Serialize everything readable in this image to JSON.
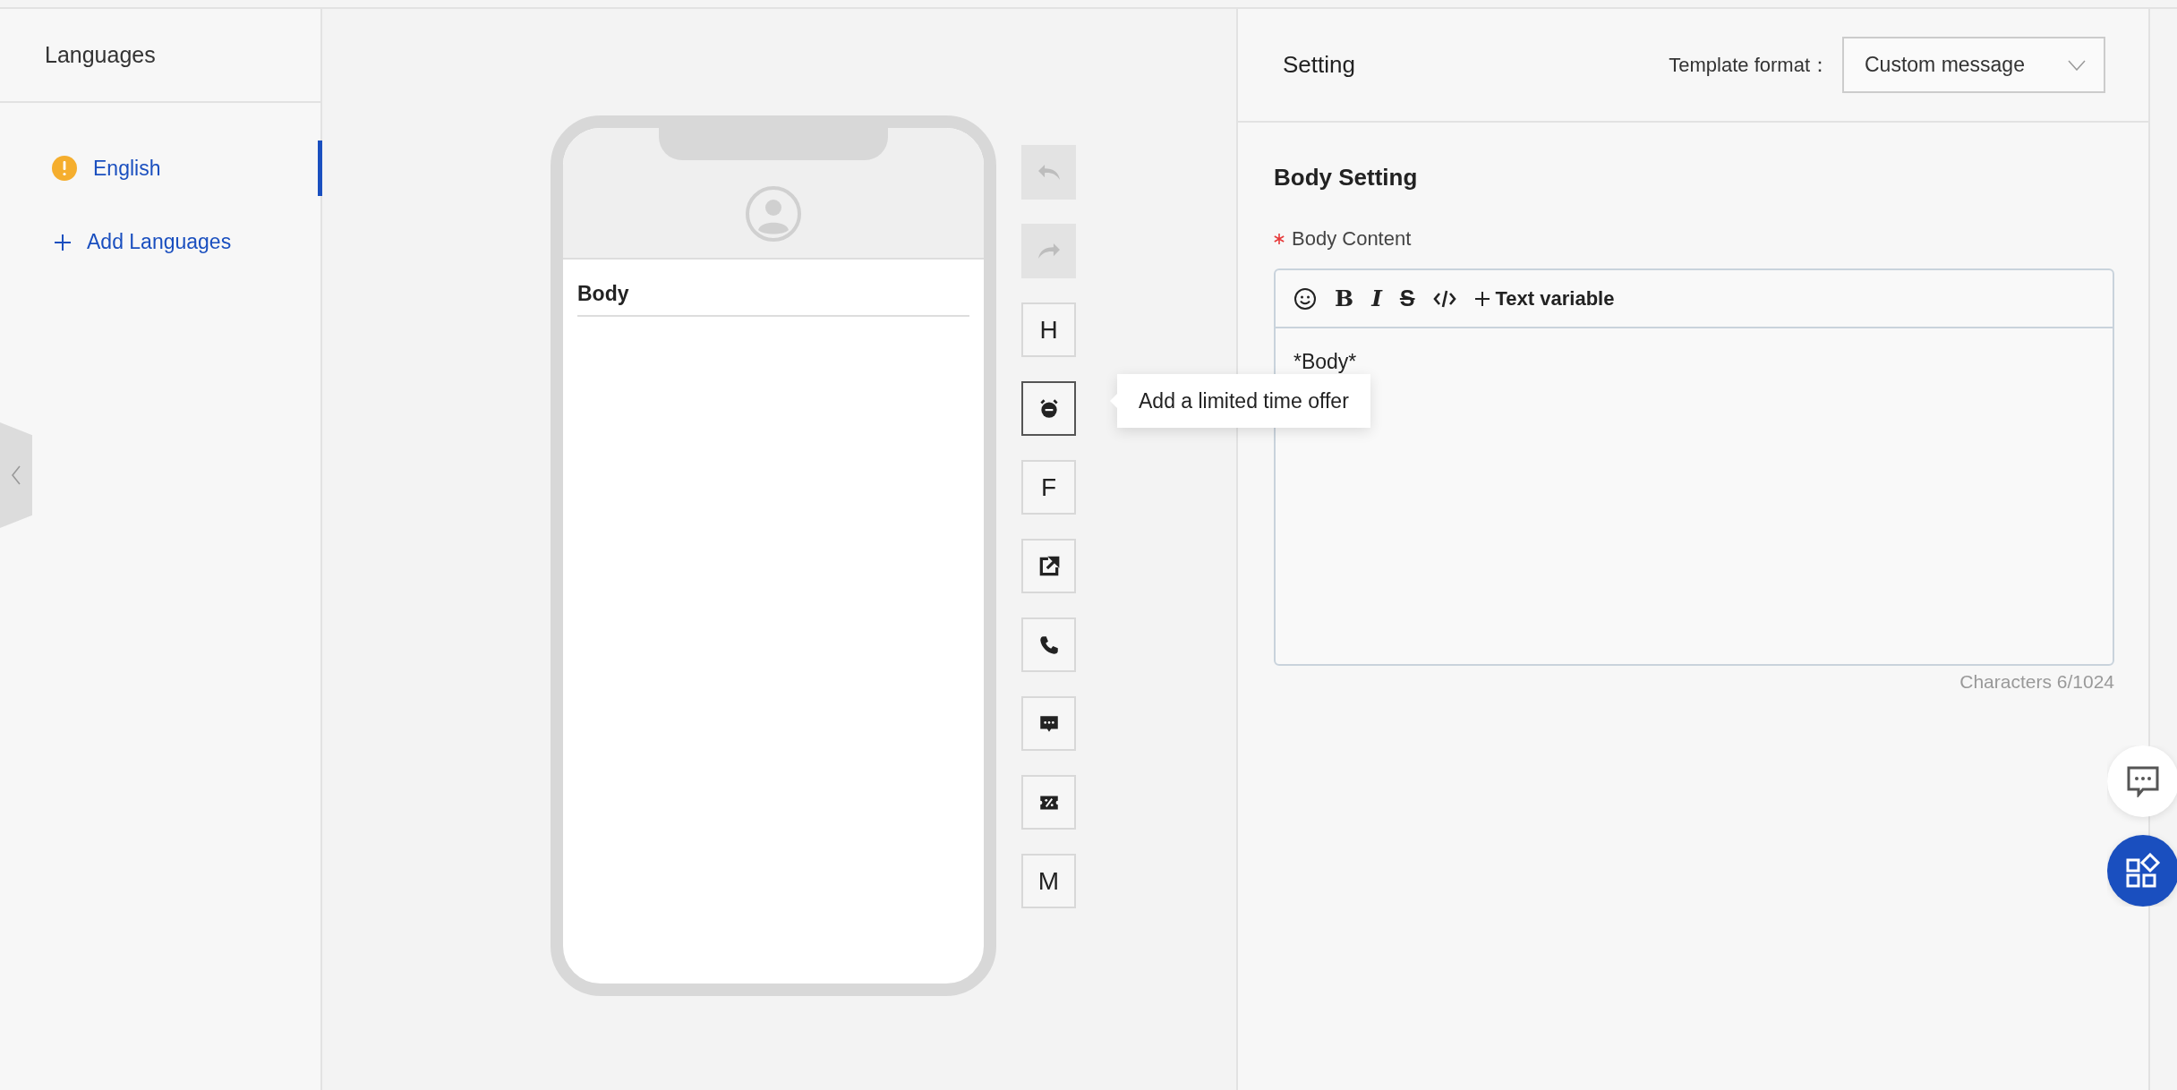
{
  "sidebar": {
    "title": "Languages",
    "items": [
      {
        "label": "English",
        "selected": true,
        "warning": true
      }
    ],
    "add_link": "Add Languages"
  },
  "preview": {
    "section_label": "Body"
  },
  "tools": [
    {
      "kind": "undo",
      "disabled": true,
      "selected": false
    },
    {
      "kind": "redo",
      "disabled": true,
      "selected": false
    },
    {
      "kind": "letter",
      "label": "H",
      "disabled": false,
      "selected": false
    },
    {
      "kind": "sale",
      "disabled": false,
      "selected": true
    },
    {
      "kind": "letter",
      "label": "F",
      "disabled": false,
      "selected": false
    },
    {
      "kind": "link",
      "disabled": false,
      "selected": false
    },
    {
      "kind": "phone",
      "disabled": false,
      "selected": false
    },
    {
      "kind": "chat",
      "disabled": false,
      "selected": false
    },
    {
      "kind": "coupon",
      "disabled": false,
      "selected": false
    },
    {
      "kind": "letter",
      "label": "M",
      "disabled": false,
      "selected": false
    }
  ],
  "tooltip": "Add a limited time offer",
  "settings": {
    "title": "Setting",
    "format_label": "Template format：",
    "format_value": "Custom message",
    "section_title": "Body Setting",
    "field_label": "Body Content",
    "required": true,
    "editor_tools": [
      {
        "kind": "emoji"
      },
      {
        "kind": "bold",
        "label": "B"
      },
      {
        "kind": "italic",
        "label": "I"
      },
      {
        "kind": "strike",
        "label": "S"
      },
      {
        "kind": "code"
      }
    ],
    "variable_button": "Text variable",
    "body_text": "*Body*",
    "counter": "Characters 6/1024"
  }
}
